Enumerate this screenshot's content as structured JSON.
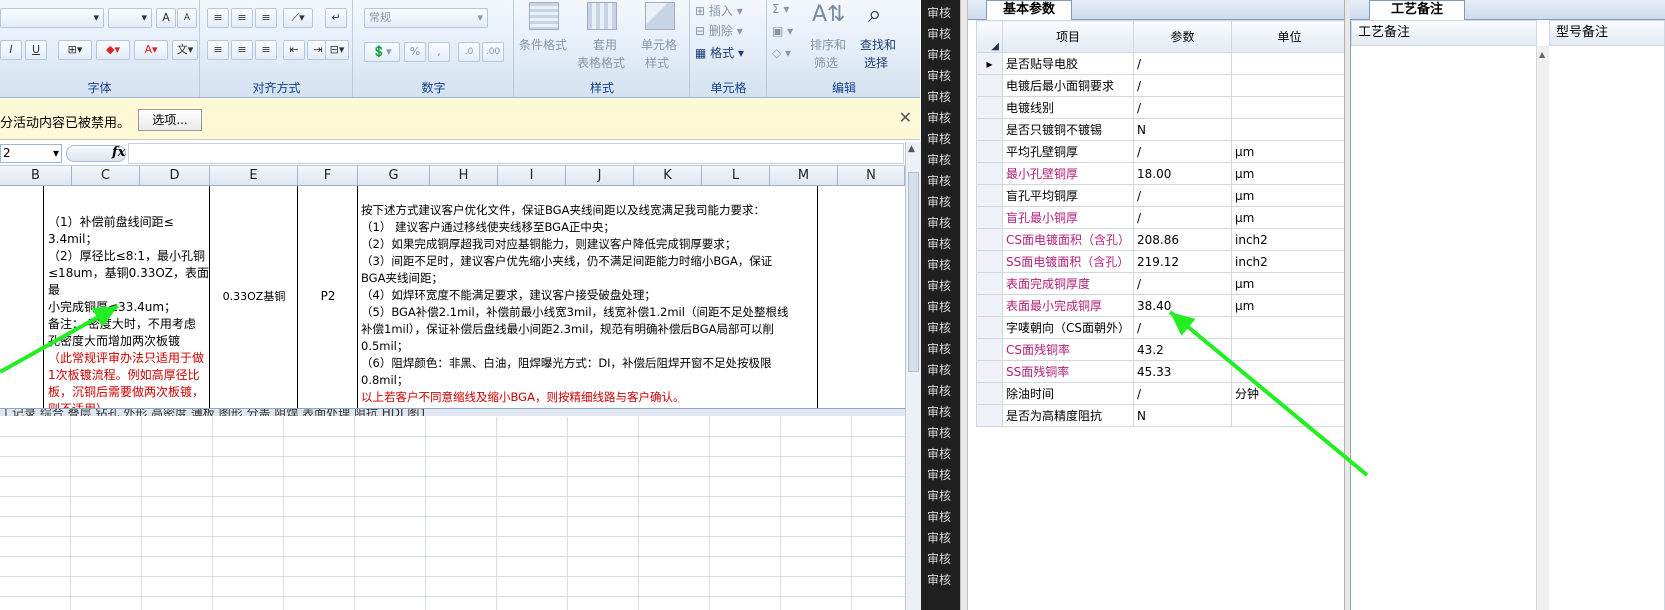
{
  "ribbon": {
    "font_group": "字体",
    "align_group": "对齐方式",
    "number_group": "数字",
    "style_group": "样式",
    "cell_group": "单元格",
    "edit_group": "编辑",
    "number_format": "常规",
    "cond_format": "条件格式",
    "table_format_1": "套用",
    "table_format_2": "表格格式",
    "cell_style_1": "单元格",
    "cell_style_2": "样式",
    "insert": "插入",
    "delete": "删除",
    "format": "格式",
    "sort_1": "排序和",
    "sort_2": "筛选",
    "find_1": "查找和",
    "find_2": "选择"
  },
  "security": {
    "message": "分活动内容已被禁用。",
    "options_label": "选项..."
  },
  "formula_bar": {
    "name_box": "2",
    "fx": "fx"
  },
  "columns": [
    "B",
    "C",
    "D",
    "E",
    "F",
    "G",
    "H",
    "I",
    "J",
    "K",
    "L",
    "M",
    "N"
  ],
  "cells": {
    "col_b_text": [
      "（1）补偿前盘线间距≤",
      "3.4mil；",
      "（2）厚径比≤8:1，最小孔铜",
      "≤18um，基铜0.33OZ，表面最",
      "小完成铜厚≤33.4um；",
      "备注：  密度大时，不用考虑",
      "孔密度大而增加两次板镀"
    ],
    "col_b_red": [
      "（此常规评审办法只适用于做",
      "1次板镀流程。例如高厚径比",
      "板，沉铜后需要做两次板镀，",
      "则不适用）"
    ],
    "base_copper": "0.33OZ基铜",
    "p_code": "P2",
    "col_g_text": [
      "按下述方式建议客户优化文件，保证BGA夹线间距以及线宽满足我司能力要求：",
      "（1） 建议客户通过移线使夹线移至BGA正中央；",
      "（2）如果完成铜厚超我司对应基铜能力，则建议客户降低完成铜厚要求；",
      "（3）间距不足时，建议客户优先缩小夹线，仍不满足间距能力时缩小BGA，保证",
      "BGA夹线间距；",
      "（4）如焊环宽度不能满足要求，建议客户接受破盘处理；",
      "（5）BGA补偿2.1mil，补偿前最小线宽3mil，线宽补偿1.2mil（间距不足处整根线",
      "补偿1mil），保证补偿后盘线最小间距2.3mil，规范有明确补偿后BGA局部可以削",
      "0.5mil；",
      "（6）阻焊颜色：非黑、白油，阻焊曝光方式：DI，补偿后阻焊开窗不足处按极限",
      "0.8mil；"
    ],
    "col_g_red": "以上若客户不同意缩线及缩小BGA，则按精细线路与客户确认。"
  },
  "sheet_tabs": "工记录  综合  叠层  钻孔  外形  高密度  薄板  图形  分盖  阻焊  表面处理  阻抗  HDI  图1",
  "dark_col_items": [
    "审核",
    "审核",
    "审核",
    "审核",
    "审核",
    "审核",
    "审核",
    "审核",
    "审核",
    "审核",
    "审核",
    "审核",
    "审核",
    "审核",
    "审核",
    "审核",
    "审核",
    "审核",
    "审核",
    "审核",
    "审核",
    "审核",
    "审核",
    "审核",
    "审核",
    "审核",
    "审核",
    "审核"
  ],
  "param_panel": {
    "tab": "基本参数",
    "headers": {
      "item": "项目",
      "param": "参数",
      "unit": "单位"
    },
    "rows": [
      {
        "item": "是否贴导电胶",
        "param": "/",
        "unit": "",
        "mag": false
      },
      {
        "item": "电镀后最小面铜要求",
        "param": "/",
        "unit": "",
        "mag": false
      },
      {
        "item": "电镀线别",
        "param": "/",
        "unit": "",
        "mag": false
      },
      {
        "item": "是否只镀铜不镀锡",
        "param": "N",
        "unit": "",
        "mag": false
      },
      {
        "item": "平均孔壁铜厚",
        "param": "/",
        "unit": "μm",
        "mag": false
      },
      {
        "item": "最小孔壁铜厚",
        "param": "18.00",
        "unit": "μm",
        "mag": true
      },
      {
        "item": "盲孔平均铜厚",
        "param": "/",
        "unit": "μm",
        "mag": false
      },
      {
        "item": "盲孔最小铜厚",
        "param": "/",
        "unit": "μm",
        "mag": true
      },
      {
        "item": "CS面电镀面积（含孔）",
        "param": "208.86",
        "unit": "inch2",
        "mag": true
      },
      {
        "item": "SS面电镀面积（含孔）",
        "param": "219.12",
        "unit": "inch2",
        "mag": true
      },
      {
        "item": "表面完成铜厚度",
        "param": "/",
        "unit": "μm",
        "mag": true
      },
      {
        "item": "表面最小完成铜厚",
        "param": "38.40",
        "unit": "μm",
        "mag": true
      },
      {
        "item": "字唛朝向（CS面朝外）",
        "param": "/",
        "unit": "",
        "mag": false
      },
      {
        "item": "CS面残铜率",
        "param": "43.2",
        "unit": "",
        "mag": true
      },
      {
        "item": "SS面残铜率",
        "param": "45.33",
        "unit": "",
        "mag": true
      },
      {
        "item": "除油时间",
        "param": "/",
        "unit": "分钟",
        "mag": false
      },
      {
        "item": "是否为高精度阻抗",
        "param": "N",
        "unit": "",
        "mag": false
      }
    ]
  },
  "notes_panel": {
    "tab": "工艺备注",
    "col1": "工艺备注",
    "col2": "型号备注"
  },
  "colors": {
    "arrow": "#22ee22",
    "magenta_label": "#b0207a",
    "red_text": "#d00000"
  }
}
